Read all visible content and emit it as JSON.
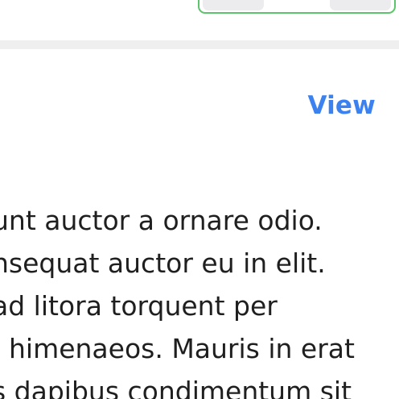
{
  "card": {
    "view_label": "View",
    "body_lines": [
      "unt auctor a ornare odio.",
      "nsequat auctor eu in elit.",
      "ad litora torquent per",
      ". himenaeos. Mauris in erat",
      "s dapibus condimentum sit"
    ]
  },
  "colors": {
    "accent": "#3b82f0",
    "segmented_border": "#5cc46a",
    "divider": "#efefef",
    "text": "#1f1f1f"
  }
}
